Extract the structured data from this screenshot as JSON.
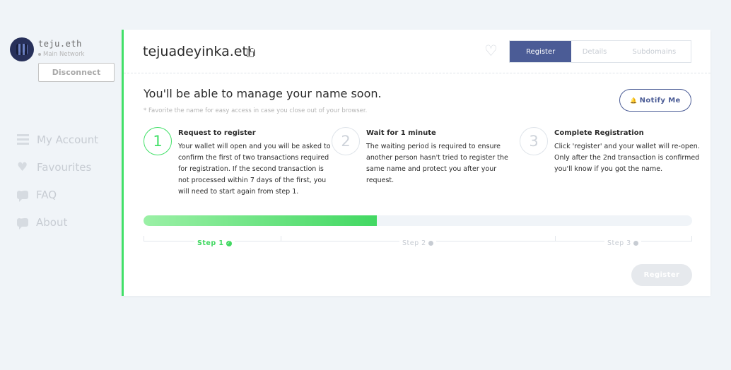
{
  "account": {
    "name": "teju.eth",
    "network": "Main Network",
    "disconnect_label": "Disconnect"
  },
  "nav": {
    "items": [
      {
        "label": "My Account",
        "icon": "list-icon"
      },
      {
        "label": "Favourites",
        "icon": "heart-icon"
      },
      {
        "label": "FAQ",
        "icon": "chat-icon"
      },
      {
        "label": "About",
        "icon": "chat-icon"
      }
    ]
  },
  "header": {
    "domain": "tejuadeyinka.eth",
    "tabs": [
      "Register",
      "Details",
      "Subdomains"
    ],
    "active_tab": "Register"
  },
  "main": {
    "headline": "You'll be able to manage your name soon.",
    "note": "* Favorite the name for easy access in case you close out of your browser.",
    "notify_label": "Notify Me",
    "steps": [
      {
        "number": "1",
        "title": "Request to register",
        "desc": "Your wallet will open and you will be asked to confirm the first of two transactions required for registration. If the second transaction is not processed within 7 days of the first, you will need to start again from step 1."
      },
      {
        "number": "2",
        "title": "Wait for 1 minute",
        "desc": "The waiting period is required to ensure another person hasn't tried to register the same name and protect you after your request."
      },
      {
        "number": "3",
        "title": "Complete Registration",
        "desc": "Click 'register' and your wallet will re-open. Only after the 2nd transaction is confirmed you'll know if you got the name."
      }
    ],
    "progress_fraction": 0.425,
    "timeline": [
      {
        "label": "Step 1",
        "status": "done"
      },
      {
        "label": "Step 2",
        "status": "pending"
      },
      {
        "label": "Step 3",
        "status": "pending"
      }
    ],
    "register_label": "Register"
  },
  "colors": {
    "accent_green": "#42e068",
    "accent_blue": "#4b5c96",
    "background": "#f0f4f8"
  }
}
